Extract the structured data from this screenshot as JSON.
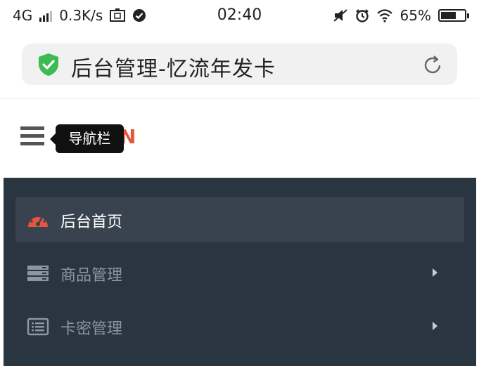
{
  "status_bar": {
    "network": "4G",
    "speed": "0.3K/s",
    "time": "02:40",
    "battery": "65%",
    "battery_level": 0.65
  },
  "browser": {
    "page_title": "后台管理-忆流年发卡",
    "shield_color": "#3cba54"
  },
  "header": {
    "tooltip": "导航栏",
    "logo_peek": "N"
  },
  "sidebar": {
    "items": [
      {
        "label": "后台首页",
        "icon": "dashboard-icon",
        "active": true
      },
      {
        "label": "商品管理",
        "icon": "server-icon",
        "has_arrow": true
      },
      {
        "label": "卡密管理",
        "icon": "list-card-icon",
        "has_arrow": true
      }
    ]
  },
  "colors": {
    "sidebar_bg": "#2a3542",
    "active_item_bg": "#38434f",
    "accent": "#e8553e"
  }
}
